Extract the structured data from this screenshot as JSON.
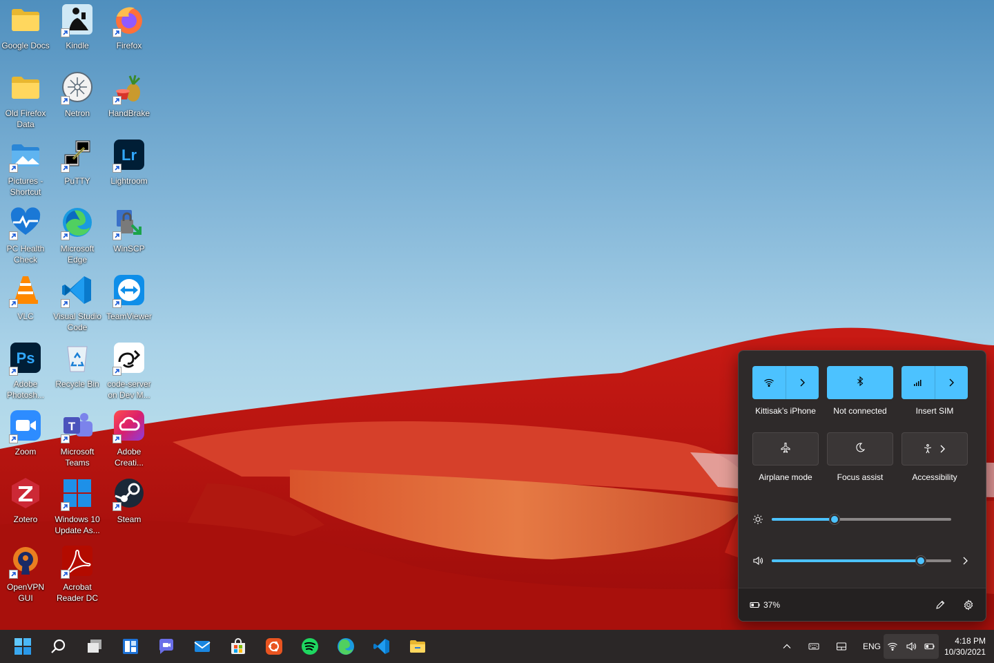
{
  "desktop": {
    "icons": [
      {
        "label": "Google Docs",
        "icon": "folder-icon",
        "shortcut": false
      },
      {
        "label": "Kindle",
        "icon": "kindle-icon",
        "shortcut": true
      },
      {
        "label": "Firefox",
        "icon": "firefox-icon",
        "shortcut": true
      },
      {
        "label": "Old Firefox\nData",
        "icon": "folder-icon",
        "shortcut": false
      },
      {
        "label": "Netron",
        "icon": "netron-icon",
        "shortcut": true
      },
      {
        "label": "HandBrake",
        "icon": "handbrake-icon",
        "shortcut": true
      },
      {
        "label": "Pictures -\nShortcut",
        "icon": "pictures-folder-icon",
        "shortcut": true
      },
      {
        "label": "PuTTY",
        "icon": "putty-icon",
        "shortcut": true
      },
      {
        "label": "Lightroom",
        "icon": "lightroom-icon",
        "shortcut": true
      },
      {
        "label": "PC Health\nCheck",
        "icon": "pc-health-check-icon",
        "shortcut": true
      },
      {
        "label": "Microsoft\nEdge",
        "icon": "edge-icon",
        "shortcut": true
      },
      {
        "label": "WinSCP",
        "icon": "winscp-icon",
        "shortcut": true
      },
      {
        "label": "VLC",
        "icon": "vlc-icon",
        "shortcut": true
      },
      {
        "label": "Visual Studio\nCode",
        "icon": "vscode-icon",
        "shortcut": true
      },
      {
        "label": "TeamViewer",
        "icon": "teamviewer-icon",
        "shortcut": true
      },
      {
        "label": "Adobe\nPhotosh...",
        "icon": "photoshop-icon",
        "shortcut": true
      },
      {
        "label": "Recycle Bin",
        "icon": "recycle-bin-icon",
        "shortcut": false
      },
      {
        "label": "code-server\non Dev M...",
        "icon": "code-server-icon",
        "shortcut": true
      },
      {
        "label": "Zoom",
        "icon": "zoom-icon",
        "shortcut": true
      },
      {
        "label": "Microsoft\nTeams",
        "icon": "teams-icon",
        "shortcut": true
      },
      {
        "label": "Adobe\nCreati...",
        "icon": "creative-cloud-icon",
        "shortcut": true
      },
      {
        "label": "Zotero",
        "icon": "zotero-icon",
        "shortcut": false
      },
      {
        "label": "Windows 10\nUpdate As...",
        "icon": "windows-update-icon",
        "shortcut": true
      },
      {
        "label": "Steam",
        "icon": "steam-icon",
        "shortcut": true
      },
      {
        "label": "OpenVPN\nGUI",
        "icon": "openvpn-icon",
        "shortcut": true
      },
      {
        "label": "Acrobat\nReader DC",
        "icon": "acrobat-icon",
        "shortcut": true
      }
    ]
  },
  "quick_settings": {
    "tiles": [
      {
        "label": "Kittisak’s iPhone",
        "icon": "wifi-icon",
        "active": true,
        "expand": true
      },
      {
        "label": "Not connected",
        "icon": "bluetooth-icon",
        "active": true,
        "expand": false
      },
      {
        "label": "Insert SIM",
        "icon": "cellular-icon",
        "active": true,
        "expand": true
      },
      {
        "label": "Airplane mode",
        "icon": "airplane-icon",
        "active": false,
        "expand": false
      },
      {
        "label": "Focus assist",
        "icon": "moon-icon",
        "active": false,
        "expand": false
      },
      {
        "label": "Accessibility",
        "icon": "accessibility-icon",
        "active": false,
        "expand": true
      }
    ],
    "brightness_level": 0.35,
    "volume_level": 0.83,
    "battery_text": "37%",
    "accent_color": "#4cc2ff"
  },
  "taskbar": {
    "apps": [
      "start-icon",
      "search-icon",
      "task-view-icon",
      "widgets-icon",
      "chat-icon",
      "mail-icon",
      "store-icon",
      "ubuntu-icon",
      "spotify-icon",
      "edge-icon",
      "vscode-icon",
      "file-explorer-icon"
    ],
    "language": "ENG",
    "time": "4:18 PM",
    "date": "10/30/2021"
  }
}
